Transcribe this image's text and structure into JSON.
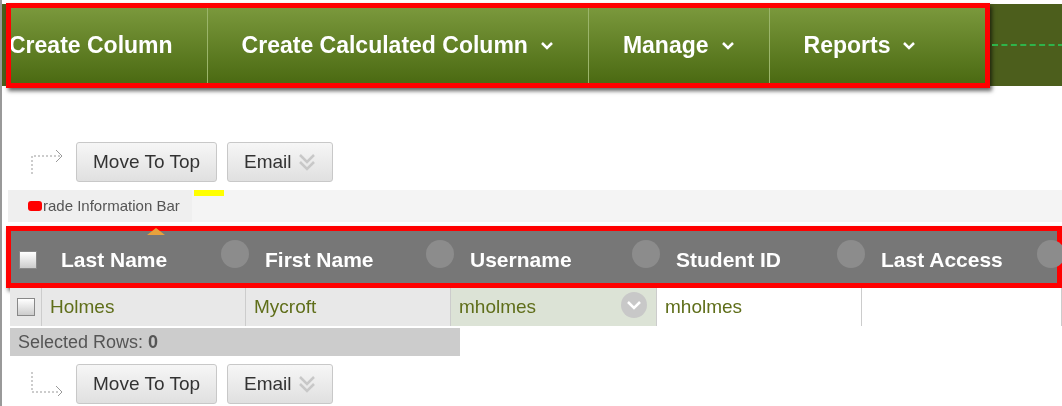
{
  "menu_bar": {
    "items": [
      {
        "label": "Create Column",
        "has_menu": false
      },
      {
        "label": "Create Calculated Column",
        "has_menu": true
      },
      {
        "label": "Manage",
        "has_menu": true
      },
      {
        "label": "Reports",
        "has_menu": true
      }
    ]
  },
  "top_actions": [
    {
      "label": "Move To Top",
      "kind": "button"
    },
    {
      "label": "Email",
      "kind": "menu"
    }
  ],
  "info_bar": {
    "label": "rade Information Bar"
  },
  "table": {
    "select_all": {
      "checked": false
    },
    "columns": [
      {
        "label": "Last Name",
        "sorted": true
      },
      {
        "label": "First Name",
        "sorted": false
      },
      {
        "label": "Username",
        "sorted": false
      },
      {
        "label": "Student ID",
        "sorted": false
      },
      {
        "label": "Last Access",
        "sorted": false
      }
    ],
    "rows": [
      {
        "checked": false,
        "cells": [
          {
            "text": "Holmes",
            "highlighted": false
          },
          {
            "text": "Mycroft",
            "highlighted": false
          },
          {
            "text": "mholmes",
            "highlighted": true
          },
          {
            "text": "mholmes",
            "highlighted": false
          },
          {
            "highlighted": false
          }
        ]
      }
    ]
  },
  "selected_rows": {
    "label": "Selected Rows: **0**"
  },
  "bottom_actions": [
    {
      "label": "Move To Top",
      "kind": "button"
    },
    {
      "label": "Email",
      "kind": "menu"
    }
  ]
}
